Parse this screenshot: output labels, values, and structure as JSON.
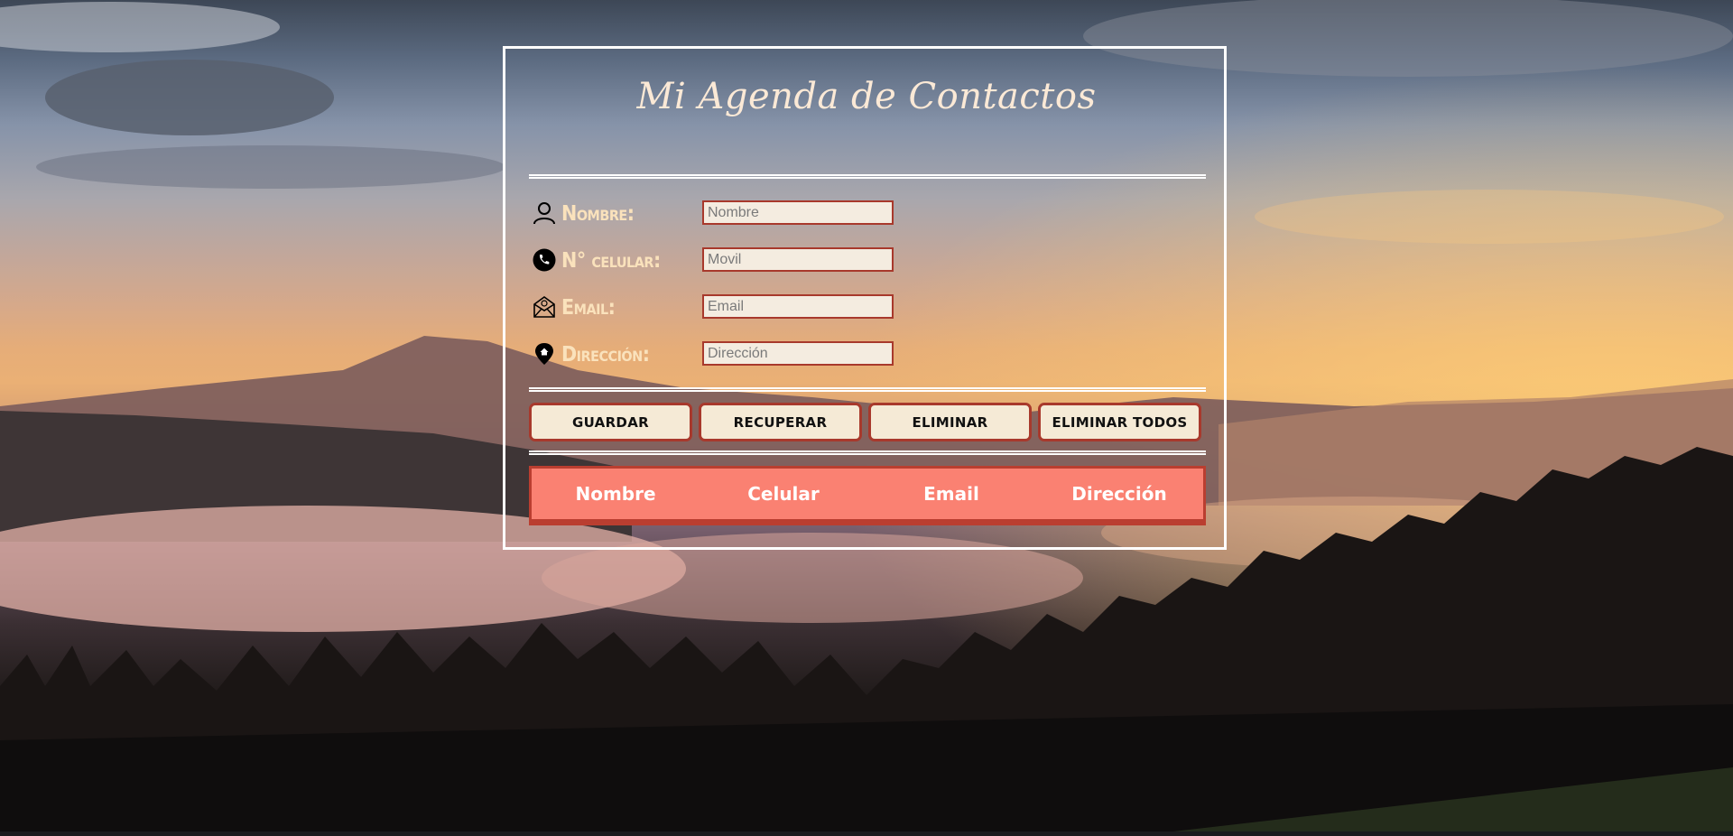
{
  "header": {
    "title": "Mi Agenda de Contactos"
  },
  "form": {
    "fields": [
      {
        "label": "Nombre:",
        "placeholder": "Nombre",
        "icon": "user-icon"
      },
      {
        "label": "N° celular:",
        "placeholder": "Movil",
        "icon": "phone-icon"
      },
      {
        "label": "Email:",
        "placeholder": "Email",
        "icon": "envelope-icon"
      },
      {
        "label": "Dirección:",
        "placeholder": "Dirección",
        "icon": "location-pin-icon"
      }
    ]
  },
  "actions": {
    "save": "GUARDAR",
    "retrieve": "RECUPERAR",
    "delete": "ELIMINAR",
    "delete_all": "ELIMINAR TODOS"
  },
  "table": {
    "columns": [
      "Nombre",
      "Celular",
      "Email",
      "Dirección"
    ],
    "rows": []
  },
  "colors": {
    "label_text": "#fae2bc",
    "input_border": "#a8392c",
    "button_bg": "#f5ead6",
    "table_header_bg": "#fa8172",
    "panel_border": "#ffffff"
  }
}
